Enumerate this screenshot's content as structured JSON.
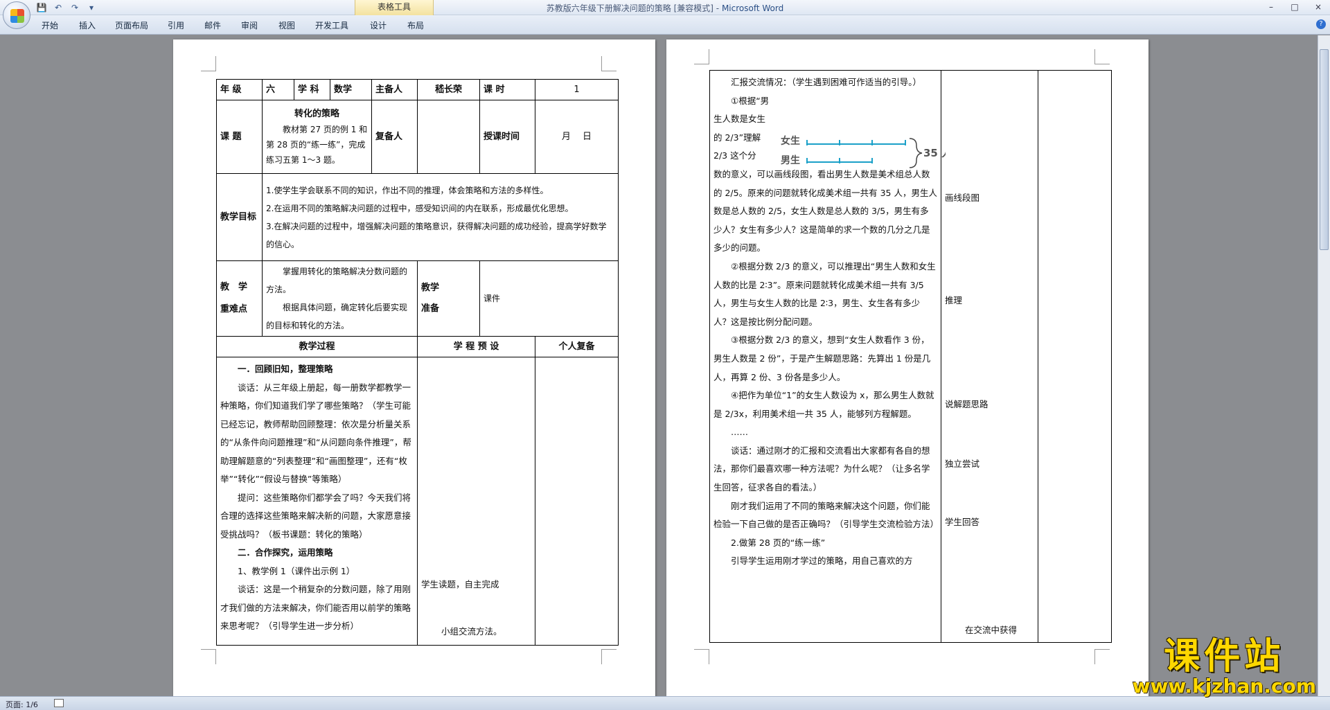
{
  "window": {
    "title": "苏教版六年级下册解决问题的策略 [兼容模式]",
    "app_name": "Microsoft Word",
    "separator": " - ",
    "context_tab_group": "表格工具",
    "controls": [
      "–",
      "□",
      "×"
    ]
  },
  "quick_access": {
    "icons": [
      "save-icon",
      "undo-icon",
      "redo-icon",
      "customize-icon"
    ],
    "glyphs": [
      "💾",
      "↶",
      "↷",
      "▾"
    ]
  },
  "ribbon_tabs": [
    "开始",
    "插入",
    "页面布局",
    "引用",
    "邮件",
    "审阅",
    "视图",
    "开发工具",
    "设计",
    "布局"
  ],
  "help_label": "?",
  "status": {
    "page_count": "页面: 1/6"
  },
  "watermark": {
    "text": "课件站",
    "url": "www.kjzhan.com"
  },
  "page1": {
    "header": {
      "grade_label": "年 级",
      "grade_value": "六",
      "subject_label": "学 科",
      "subject_value": "数学",
      "preparer_label": "主备人",
      "preparer_value": "嵇长荣",
      "period_label": "课 时",
      "period_value": "1"
    },
    "topic": {
      "label": "课 题",
      "title": "转化的策略",
      "content": "教材第 27 页的例 1 和第 28 页的“练一练”，完成练习五第 1～3 题。",
      "co_preparer_label": "复备人",
      "co_preparer_value": "",
      "date_label": "授课时间",
      "date_value": "月　 日"
    },
    "goals": {
      "label": "教学目标",
      "items": [
        "1.使学生学会联系不同的知识，作出不同的推理，体会策略和方法的多样性。",
        "2.在运用不同的策略解决问题的过程中，感受知识间的内在联系，形成最优化思想。",
        "3.在解决问题的过程中，增强解决问题的策略意识，获得解决问题的成功经验，提高学好数学的信心。"
      ]
    },
    "keypoints": {
      "label_1": "教　学",
      "label_2": "重难点",
      "items": [
        "掌握用转化的策略解决分数问题的方法。",
        "根据具体问题，确定转化后要实现的目标和转化的方法。"
      ],
      "prep_label_1": "教学",
      "prep_label_2": "准备",
      "prep_value": "课件"
    },
    "process_headers": {
      "process": "教学过程",
      "prediction": "学 程 预 设",
      "personal": "个人复备"
    },
    "process": {
      "section1": "一．回顾旧知，整理策略",
      "p1": "谈话：从三年级上册起，每一册数学都教学一种策略，你们知道我们学了哪些策略？（学生可能已经忘记，教师帮助回顾整理：依次是分析量关系的“从条件向问题推理”和“从问题向条件推理”，帮助理解题意的“列表整理”和“画图整理”，还有“枚举”“转化”“假设与替换”等策略）",
      "p2": "提问：这些策略你们都学会了吗？今天我们将合理的选择这些策略来解决新的问题，大家愿意接受挑战吗？（板书课题：转化的策略）",
      "section2": "二．合作探究，运用策略",
      "p3": "1、教学例 1（课件出示例 1）",
      "p4": "谈话：这是一个稍复杂的分数问题，除了用刚才我们做的方法来解决，你们能否用以前学的策略来思考呢？（引导学生进一步分析）"
    },
    "prediction": {
      "item1": "学生读题，自主完成",
      "item2": "小组交流方法。"
    }
  },
  "page2": {
    "p_intro": "汇报交流情况：（学生遇到困难可作适当的引导。）",
    "p_1_short": "①根据“男生人数是女生的 2/3”理解 2/3 这个分",
    "p_1_rest": "数的意义，可以画线段图，看出男生人数是美术组总人数的 2/5。原来的问题就转化成美术组一共有 35 人，男生人数是总人数的 2/5，女生人数是总人数的 3/5，男生有多少人？女生有多少人？这是简单的求一个数的几分之几是多少的问题。",
    "diagram": {
      "girls_label": "女生",
      "boys_label": "男生",
      "total_label": "35 人"
    },
    "p_2": "②根据分数 2/3 的意义，可以推理出“男生人数和女生人数的比是 2∶3”。原来问题就转化成美术组一共有 3/5 人，男生与女生人数的比是 2∶3，男生、女生各有多少人？这是按比例分配问题。",
    "p_3": "③根据分数 2/3 的意义，想到“女生人数看作 3 份，男生人数是 2 份”，于是产生解题思路：先算出 1 份是几人，再算 2 份、3 份各是多少人。",
    "p_4": "④把作为单位“1”的女生人数设为 x，那么男生人数就是 2/3x，利用美术组一共 35 人，能够列方程解题。",
    "ellipsis": "……",
    "p_talk": "谈话：通过刚才的汇报和交流看出大家都有各自的想法，那你们最喜欢哪一种方法呢？为什么呢？（让多名学生回答，征求各自的看法。）",
    "p_check": "刚才我们运用了不同的策略来解决这个问题，你们能检验一下自己做的是否正确吗？（引导学生交流检验方法）",
    "p_practice": "2.做第 28 页的“练一练”",
    "p_guide": "引导学生运用刚才学过的策略，用自己喜欢的方",
    "prediction": {
      "item1": "画线段图",
      "item2": "推理",
      "item3": "说解题思路",
      "item4": "独立尝试",
      "item5": "学生回答",
      "item6": "在交流中获得"
    }
  }
}
